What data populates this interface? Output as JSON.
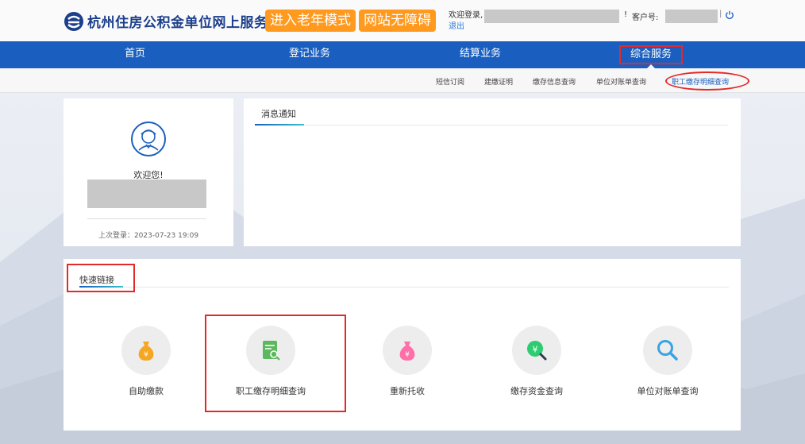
{
  "header": {
    "site_title": "杭州住房公积金单位网上服务大厅",
    "elder_mode": "进入老年模式",
    "accessibility": "网站无障碍",
    "welcome": "欢迎登录,",
    "logout": "退出",
    "exclaim": "!",
    "customer_label": "客户号:",
    "separator": "|",
    "power_icon": "power-icon"
  },
  "nav": {
    "items": [
      {
        "label": "首页"
      },
      {
        "label": "登记业务"
      },
      {
        "label": "结算业务"
      },
      {
        "label": "综合服务"
      }
    ]
  },
  "subnav": {
    "items": [
      {
        "label": "短信订阅"
      },
      {
        "label": "建缴证明"
      },
      {
        "label": "缴存信息查询"
      },
      {
        "label": "单位对账单查询"
      },
      {
        "label": "职工缴存明细查询"
      }
    ]
  },
  "user_panel": {
    "welcome": "欢迎您!",
    "last_login": "上次登录：2023-07-23 19:09"
  },
  "message_panel": {
    "tab": "消息通知"
  },
  "quick_links": {
    "title": "快速链接",
    "items": [
      {
        "label": "自助缴款",
        "icon": "money-bag-icon",
        "color": "#f5a623"
      },
      {
        "label": "职工缴存明细查询",
        "icon": "document-search-icon",
        "color": "#5cb85c"
      },
      {
        "label": "重新托收",
        "icon": "money-bag-icon",
        "color": "#ff6fa8"
      },
      {
        "label": "缴存资金查询",
        "icon": "yuan-search-icon",
        "color": "#2ecc71"
      },
      {
        "label": "单位对账单查询",
        "icon": "search-icon",
        "color": "#3aa3e3"
      }
    ]
  },
  "colors": {
    "nav_bg": "#1a5fbf",
    "highlight": "#e32a2a",
    "orange_button": "#ff9a1f"
  }
}
